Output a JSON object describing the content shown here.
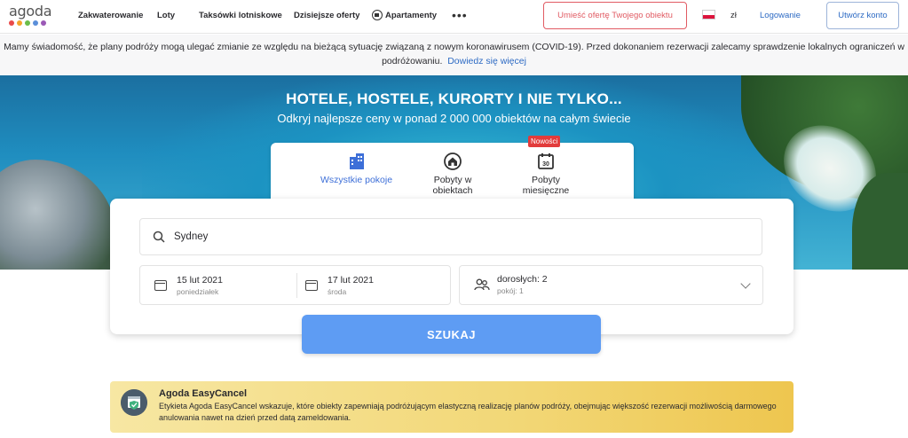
{
  "brand": {
    "logo_text": "agoda",
    "dot_colors": [
      "#e94a4a",
      "#f4a52a",
      "#6bbd4a",
      "#5b8fd9",
      "#9b59b6"
    ]
  },
  "nav": {
    "items": [
      "Zakwaterowanie",
      "Loty",
      "Taksówki lotniskowe",
      "Dzisiejsze oferty",
      "Apartamenty"
    ],
    "more_icon": "more-dots-icon",
    "post_listing": "Umieść ofertę Twojego obiektu",
    "currency": "zł",
    "login": "Logowanie",
    "create_account": "Utwórz konto"
  },
  "notice": {
    "text": "Mamy świadomość, że plany podróży mogą ulegać zmianie ze względu na bieżącą sytuację związaną z nowym koronawirusem (COVID-19). Przed dokonaniem rezerwacji zalecamy sprawdzenie lokalnych ograniczeń w podróżowaniu.",
    "link": "Dowiedz się więcej"
  },
  "hero": {
    "title": "HOTELE, HOSTELE, KURORTY I NIE TYLKO...",
    "subtitle": "Odkryj najlepsze ceny w ponad 2 000 000 obiektów na całym świecie"
  },
  "tabs": [
    {
      "label": "Wszystkie pokoje",
      "icon": "buildings-icon",
      "active": true
    },
    {
      "label": "Pobyty w obiektach",
      "icon": "home-icon",
      "active": false
    },
    {
      "label": "Pobyty miesięczne",
      "icon": "calendar-30-icon",
      "active": false,
      "badge": "Nowości"
    }
  ],
  "search": {
    "destination": "Sydney",
    "checkin_date": "15 lut 2021",
    "checkin_day": "poniedziałek",
    "checkout_date": "17 lut 2021",
    "checkout_day": "środa",
    "guests": "dorosłych: 2",
    "rooms": "pokój: 1",
    "button": "SZUKAJ"
  },
  "easycancel": {
    "title": "Agoda EasyCancel",
    "body": "Etykieta Agoda EasyCancel wskazuje, które obiekty zapewniają podróżującym elastyczną realizację planów podróży, obejmując większość rezerwacji możliwością darmowego anulowania nawet na dzień przed datą zameldowania.",
    "icon": "calendar-shield-icon"
  },
  "colors": {
    "accent": "#3d6fd8",
    "search_button": "#5e9cf3",
    "post_button": "#e15b63",
    "badge": "#e23b3b"
  }
}
